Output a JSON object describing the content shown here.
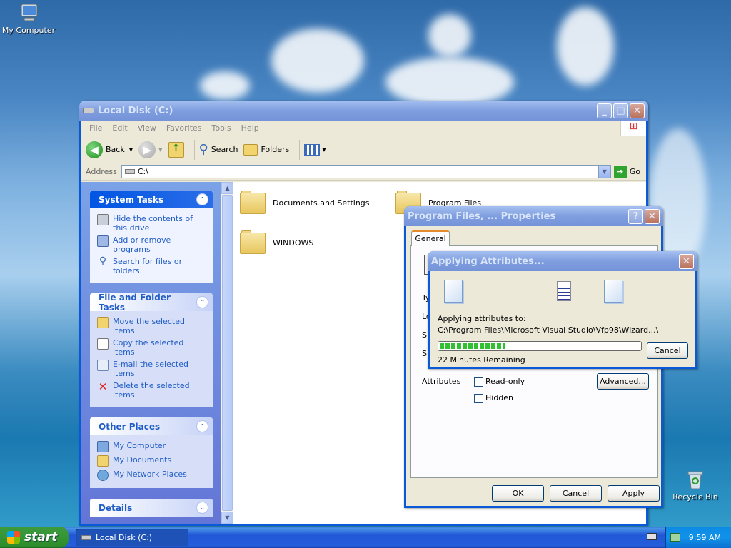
{
  "desktop": {
    "icons": [
      {
        "label": "My Computer"
      },
      {
        "label": "Recycle Bin"
      }
    ]
  },
  "explorer": {
    "title": "Local Disk (C:)",
    "menu": [
      "File",
      "Edit",
      "View",
      "Favorites",
      "Tools",
      "Help"
    ],
    "toolbar": {
      "back": "Back",
      "search": "Search",
      "folders": "Folders"
    },
    "address": {
      "label": "Address",
      "value": "C:\\",
      "go": "Go"
    },
    "panels": {
      "system_tasks": {
        "title": "System Tasks",
        "items": [
          "Hide the contents of this drive",
          "Add or remove programs",
          "Search for files or folders"
        ]
      },
      "file_folder_tasks": {
        "title": "File and Folder Tasks",
        "items": [
          "Move the selected items",
          "Copy the selected items",
          "E-mail the selected items",
          "Delete the selected items"
        ]
      },
      "other_places": {
        "title": "Other Places",
        "items": [
          "My Computer",
          "My Documents",
          "My Network Places"
        ]
      },
      "details": {
        "title": "Details"
      }
    },
    "folders": [
      "Documents and Settings",
      "Program Files",
      "WINDOWS"
    ]
  },
  "properties": {
    "title": "Program Files, ... Properties",
    "tab": "General",
    "row_labels": [
      "Ty",
      "Lo",
      "Siz",
      "Siz"
    ],
    "attributes_label": "Attributes",
    "readonly": "Read-only",
    "hidden": "Hidden",
    "advanced": "Advanced...",
    "ok": "OK",
    "cancel": "Cancel",
    "apply": "Apply"
  },
  "applying": {
    "title": "Applying Attributes...",
    "label": "Applying attributes to:",
    "path": "C:\\Program Files\\Microsoft Visual Studio\\Vfp98\\Wizard...\\",
    "remaining": "22 Minutes Remaining",
    "progress": 0.33,
    "cancel": "Cancel"
  },
  "taskbar": {
    "start": "start",
    "task": "Local Disk (C:)",
    "clock": "9:59 AM"
  },
  "colors": {
    "xp_blue": "#0054e3",
    "link_blue": "#215dc6",
    "progress_green": "#2fc12f"
  }
}
